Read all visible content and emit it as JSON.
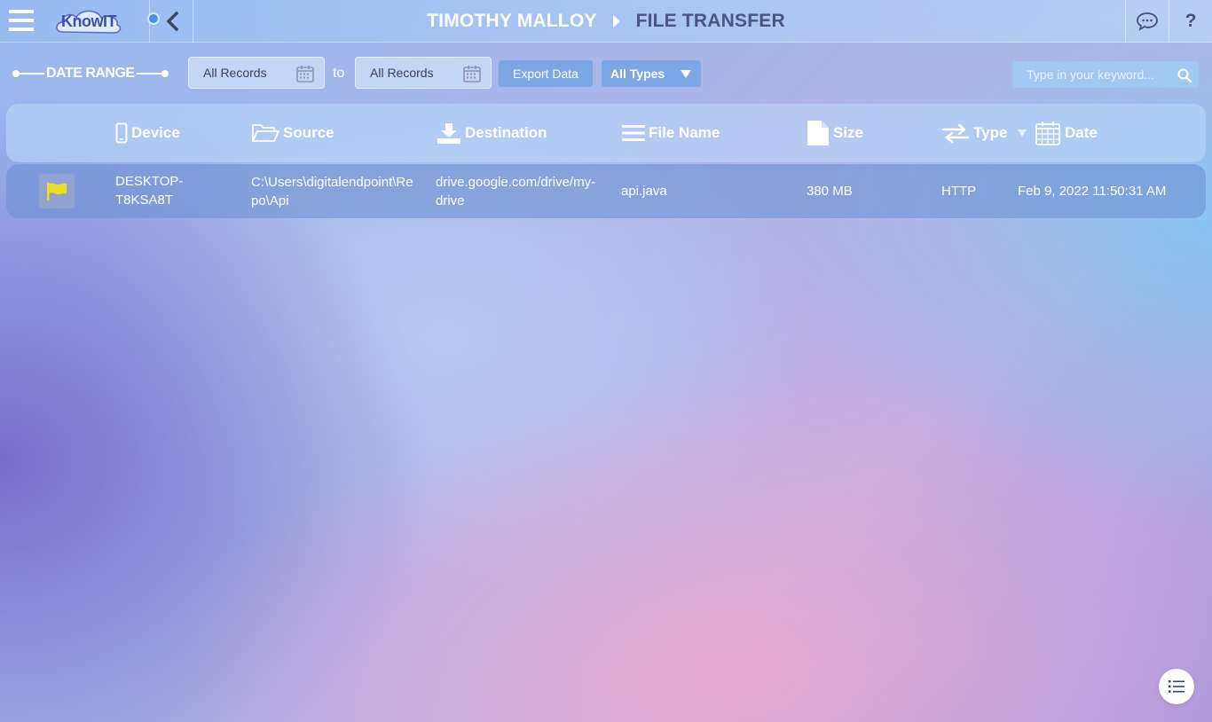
{
  "header": {
    "logo_text": "KnowIT",
    "user_name": "TIMOTHY MALLOY",
    "page_title": "FILE TRANSFER",
    "help_label": "?"
  },
  "toolbar": {
    "date_range_label": "DATE RANGE",
    "from_value": "All Records",
    "to_label": "to",
    "to_value": "All Records",
    "export_label": "Export Data",
    "types_label": "All Types",
    "search_placeholder": "Type in your keyword..."
  },
  "table": {
    "columns": [
      {
        "label": "Device",
        "icon": "mobile-icon"
      },
      {
        "label": "Source",
        "icon": "folder-icon"
      },
      {
        "label": "Destination",
        "icon": "download-icon"
      },
      {
        "label": "File Name",
        "icon": "lines-icon"
      },
      {
        "label": "Size",
        "icon": "file-icon"
      },
      {
        "label": "Type",
        "icon": "transfer-icon"
      },
      {
        "label": "Date",
        "icon": "calendar-icon"
      }
    ],
    "rows": [
      {
        "flag_color": "#e8e020",
        "device_line1": "DESKTOP-",
        "device_line2": "T8KSA8T",
        "source_line1": "C:\\Users\\digitalendpoint\\Re",
        "source_line2": "po\\Api",
        "destination_line1": "drive.google.com/drive/my-",
        "destination_line2": "drive",
        "file_name": "api.java",
        "size": "380 MB",
        "type": "HTTP",
        "date": "Feb 9, 2022 11:50:31 AM"
      }
    ]
  },
  "colors": {
    "accent": "#4a90f0",
    "page_title": "#4a5580",
    "flag": "#e8e020"
  }
}
